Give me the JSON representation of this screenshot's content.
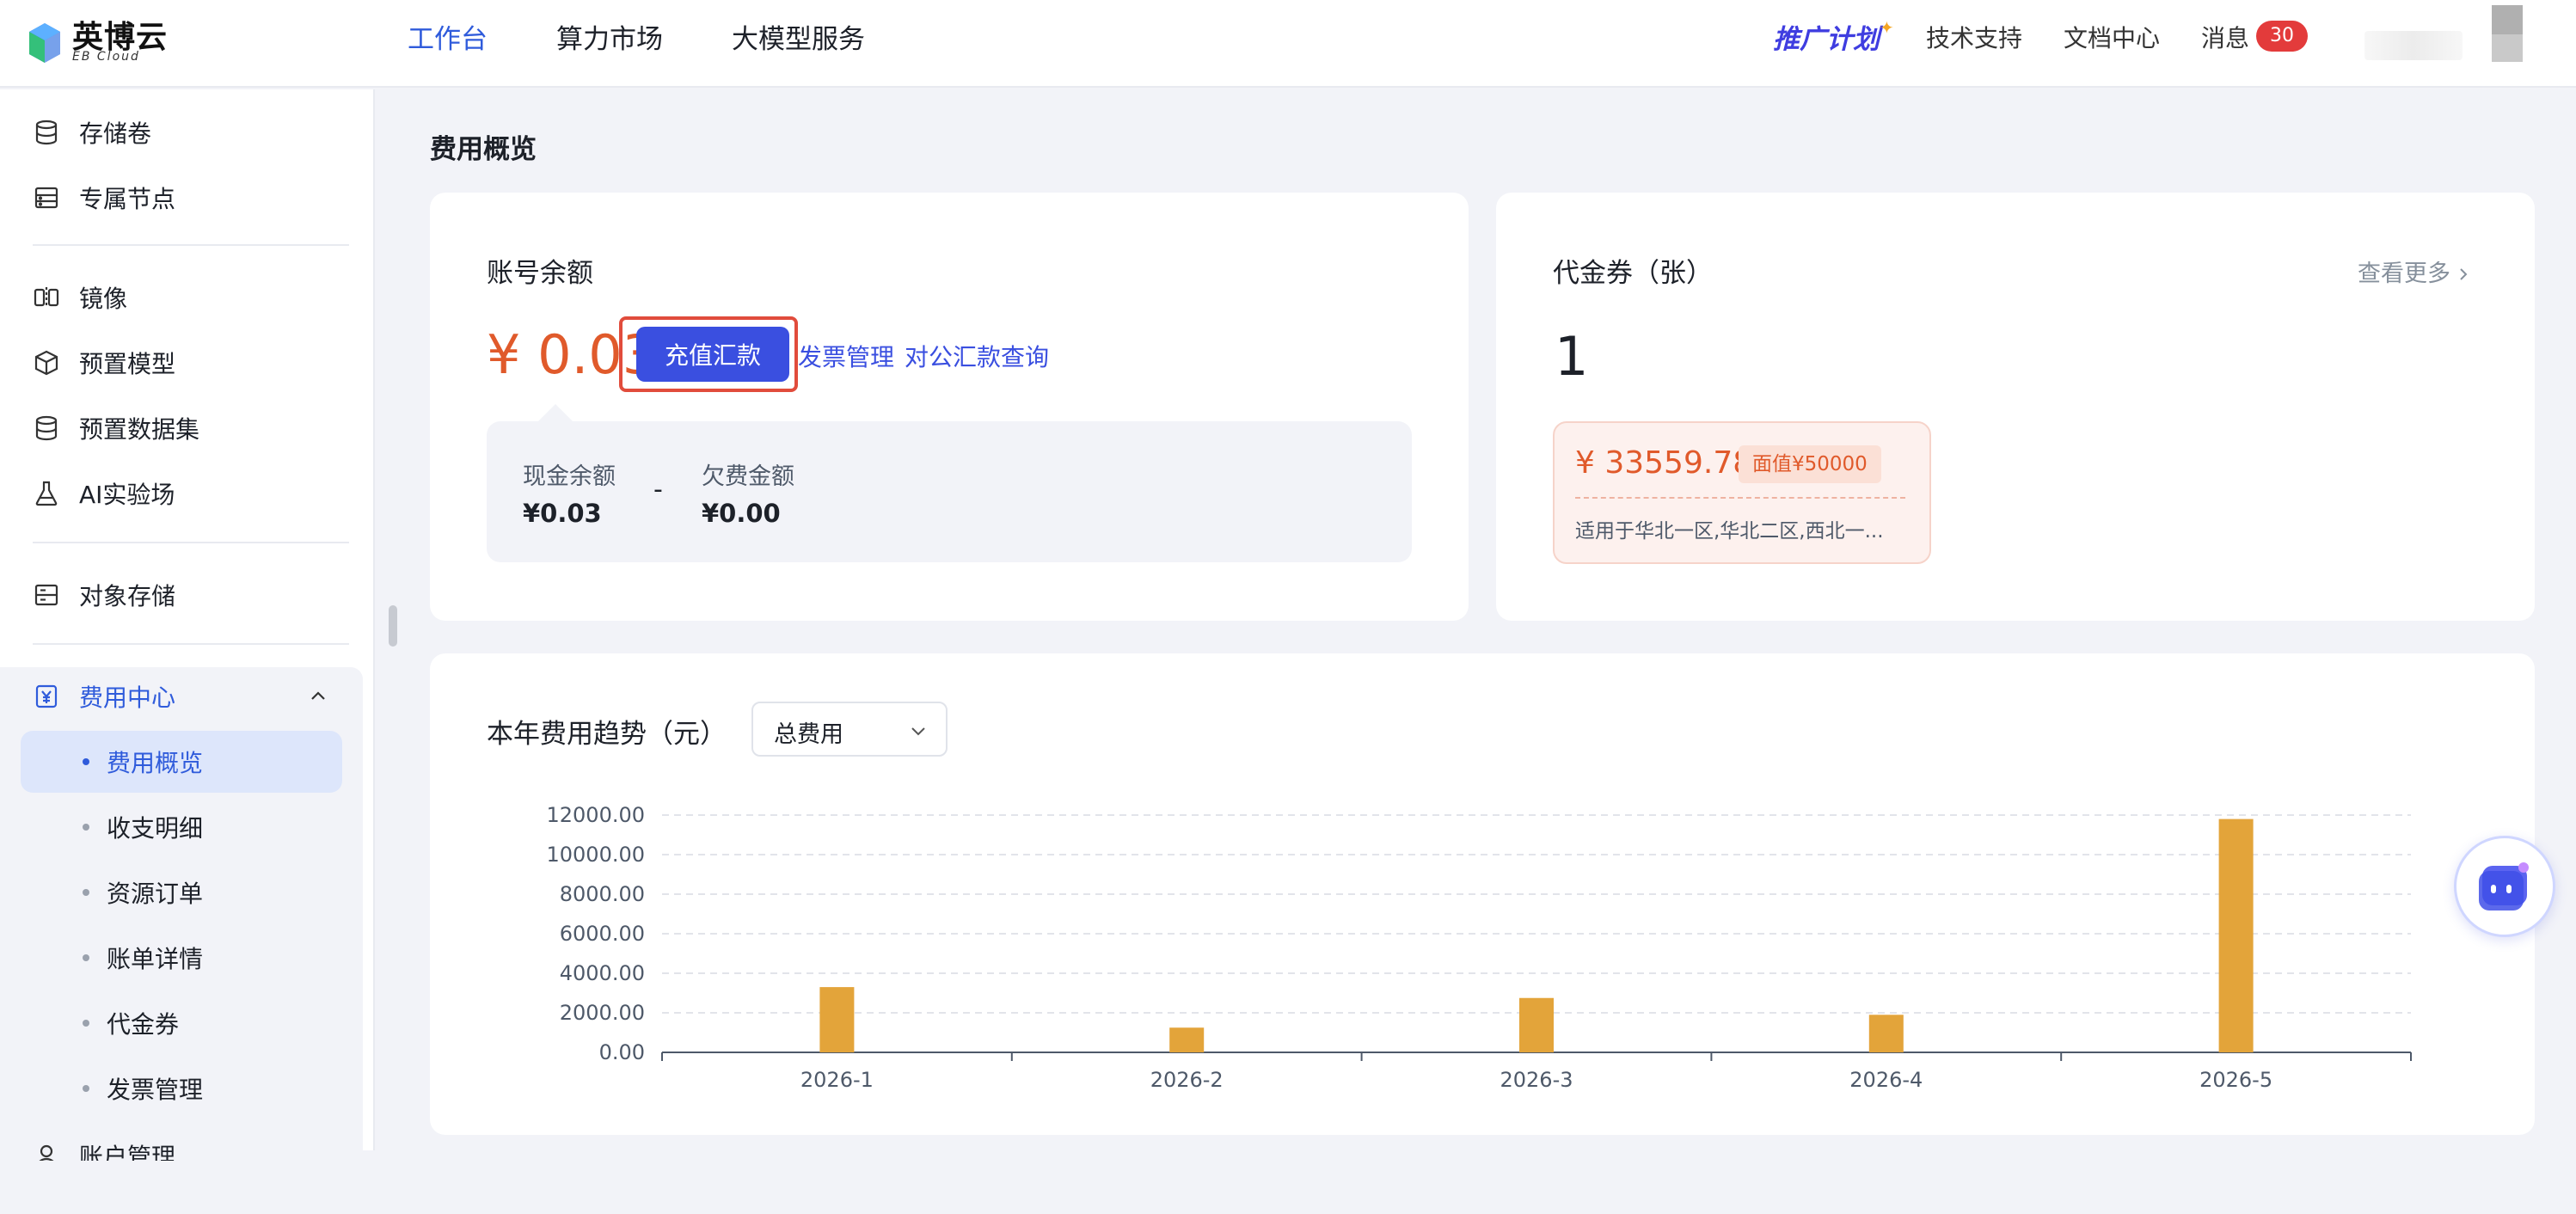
{
  "brand": {
    "name_cn": "英博云",
    "name_en": "EB Cloud"
  },
  "topnav": [
    {
      "label": "工作台",
      "active": true
    },
    {
      "label": "算力市场",
      "active": false
    },
    {
      "label": "大模型服务",
      "active": false
    }
  ],
  "topright": {
    "promo": "推广计划",
    "support": "技术支持",
    "docs": "文档中心",
    "messages": "消息",
    "message_count": "30"
  },
  "sidebar": {
    "items": [
      {
        "label": "存储卷",
        "icon": "database-icon"
      },
      {
        "label": "专属节点",
        "icon": "server-icon"
      },
      {
        "label": "镜像",
        "icon": "mirror-icon"
      },
      {
        "label": "预置模型",
        "icon": "cube-icon"
      },
      {
        "label": "预置数据集",
        "icon": "dataset-icon"
      },
      {
        "label": "AI实验场",
        "icon": "flask-icon"
      },
      {
        "label": "对象存储",
        "icon": "storage-icon"
      }
    ],
    "group": {
      "label": "费用中心",
      "icon": "yuan-icon",
      "expanded": true,
      "children": [
        {
          "label": "费用概览",
          "active": true
        },
        {
          "label": "收支明细",
          "active": false
        },
        {
          "label": "资源订单",
          "active": false
        },
        {
          "label": "账单详情",
          "active": false
        },
        {
          "label": "代金券",
          "active": false
        },
        {
          "label": "发票管理",
          "active": false
        }
      ]
    },
    "next_item_partial": "账户管理"
  },
  "page": {
    "title": "费用概览"
  },
  "balance_card": {
    "title": "账号余额",
    "amount": "¥ 0.03",
    "recharge_button": "充值汇款",
    "invoice_link": "发票管理",
    "corporate_link": "对公汇款查询",
    "cash_label": "现金余额",
    "cash_value": "¥0.03",
    "separator": "-",
    "owed_label": "欠费金额",
    "owed_value": "¥0.00"
  },
  "coupon_card": {
    "title": "代金券（张）",
    "more_link": "查看更多",
    "count": "1",
    "coupon": {
      "amount": "¥ 33559.78",
      "face_value": "面值¥50000",
      "description": "适用于华北一区,华北二区,西北一..."
    }
  },
  "trend_card": {
    "title": "本年费用趋势（元）",
    "select_value": "总费用"
  },
  "chart_data": {
    "type": "bar",
    "categories": [
      "2026-1",
      "2026-2",
      "2026-3",
      "2026-4",
      "2026-5"
    ],
    "values": [
      3300,
      1250,
      2750,
      1900,
      11800
    ],
    "ylim": [
      0,
      12000
    ],
    "yticks": [
      "0.00",
      "2000.00",
      "4000.00",
      "6000.00",
      "8000.00",
      "10000.00",
      "12000.00"
    ],
    "grid": true,
    "bar_color": "#e3a43a"
  },
  "colors": {
    "accent": "#2f5bdb",
    "button": "#3a4fe0",
    "money": "#e05a2b",
    "badge": "#e33b3b"
  }
}
